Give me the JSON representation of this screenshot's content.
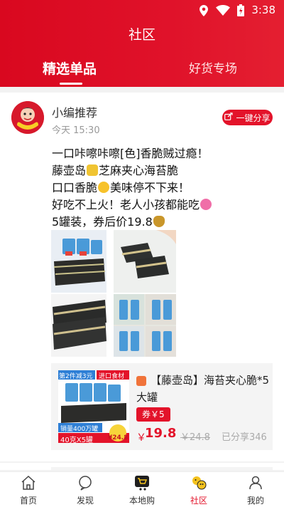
{
  "status_bar": {
    "time": "3:38"
  },
  "header": {
    "title": "社区",
    "tabs": [
      {
        "label": "精选单品",
        "active": true
      },
      {
        "label": "好货专场",
        "active": false
      }
    ]
  },
  "post": {
    "author": "小编推荐",
    "time": "今天 15:30",
    "share_label": "一键分享",
    "lines": [
      "一口咔嚓咔嚓[色]香脆贼过瘾！",
      "藤壶岛",
      "芝麻夹心海苔脆",
      "口口香脆",
      "美味停不下来！",
      "好吃不上火！老人小孩都能吃",
      "5罐装，券后价19.8"
    ],
    "product": {
      "title": "【藤壶岛】海苔夹心脆*5大罐",
      "coupon": "券￥5",
      "price_symbol": "￥",
      "price": "19.8",
      "original_price": "￥24.8",
      "shared": "已分享346",
      "thumb_badge_top": "第2件减3元",
      "thumb_badge_import": "进口食材",
      "thumb_sales": "销量400万罐",
      "thumb_bottom": "40克X5罐",
      "thumb_price": "¥24.8"
    }
  },
  "bottom_nav": [
    {
      "label": "首页",
      "icon": "home-icon",
      "active": false
    },
    {
      "label": "发现",
      "icon": "discover-icon",
      "active": false
    },
    {
      "label": "本地购",
      "icon": "cart-icon",
      "active": false
    },
    {
      "label": "社区",
      "icon": "community-icon",
      "active": true
    },
    {
      "label": "我的",
      "icon": "user-icon",
      "active": false
    }
  ],
  "colors": {
    "brand_red": "#e3132a",
    "header_red": "#d9081f"
  }
}
